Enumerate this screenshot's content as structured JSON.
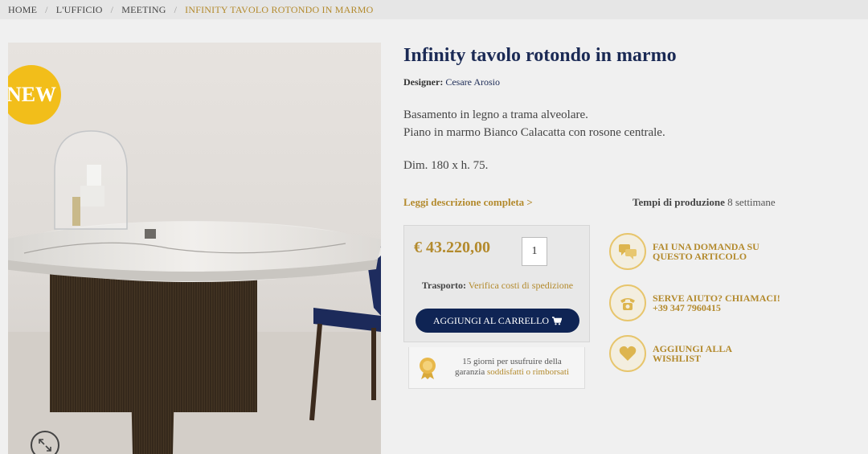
{
  "breadcrumb": {
    "items": [
      "HOME",
      "L'UFFICIO",
      "MEETING"
    ],
    "current": "INFINITY TAVOLO ROTONDO IN MARMO"
  },
  "image": {
    "badge": "NEW"
  },
  "product": {
    "title": "Infinity tavolo rotondo in marmo",
    "designer_label": "Designer:",
    "designer_name": "Cesare Arosio",
    "desc_line1": "Basamento in legno a trama alveolare.",
    "desc_line2": "Piano in marmo Bianco Calacatta con rosone centrale.",
    "dimensions": "Dim. 180 x h. 75.",
    "read_more": "Leggi descrizione completa >",
    "production_label": "Tempi di produzione",
    "production_value": "8 settimane"
  },
  "purchase": {
    "price": "€ 43.220,00",
    "quantity": "1",
    "shipping_label": "Trasporto:",
    "shipping_link": "Verifica costi di spedizione",
    "add_to_cart": "AGGIUNGI AL CARRELLO"
  },
  "guarantee": {
    "line1": "15 giorni per usufruire della",
    "line2_prefix": "garanzia",
    "line2_link": "soddisfatti o rimborsati"
  },
  "actions": [
    {
      "line1": "FAI UNA DOMANDA SU",
      "line2": "QUESTO ARTICOLO",
      "icon": "chat-icon"
    },
    {
      "line1": "SERVE AIUTO? CHIAMACI!",
      "line2": "+39 347 7960415",
      "icon": "phone-icon"
    },
    {
      "line1": "AGGIUNGI ALLA",
      "line2": "WISHLIST",
      "icon": "heart-icon"
    }
  ],
  "colors": {
    "gold": "#b38a2d",
    "navy": "#0f2454",
    "badge": "#f2be1a"
  }
}
